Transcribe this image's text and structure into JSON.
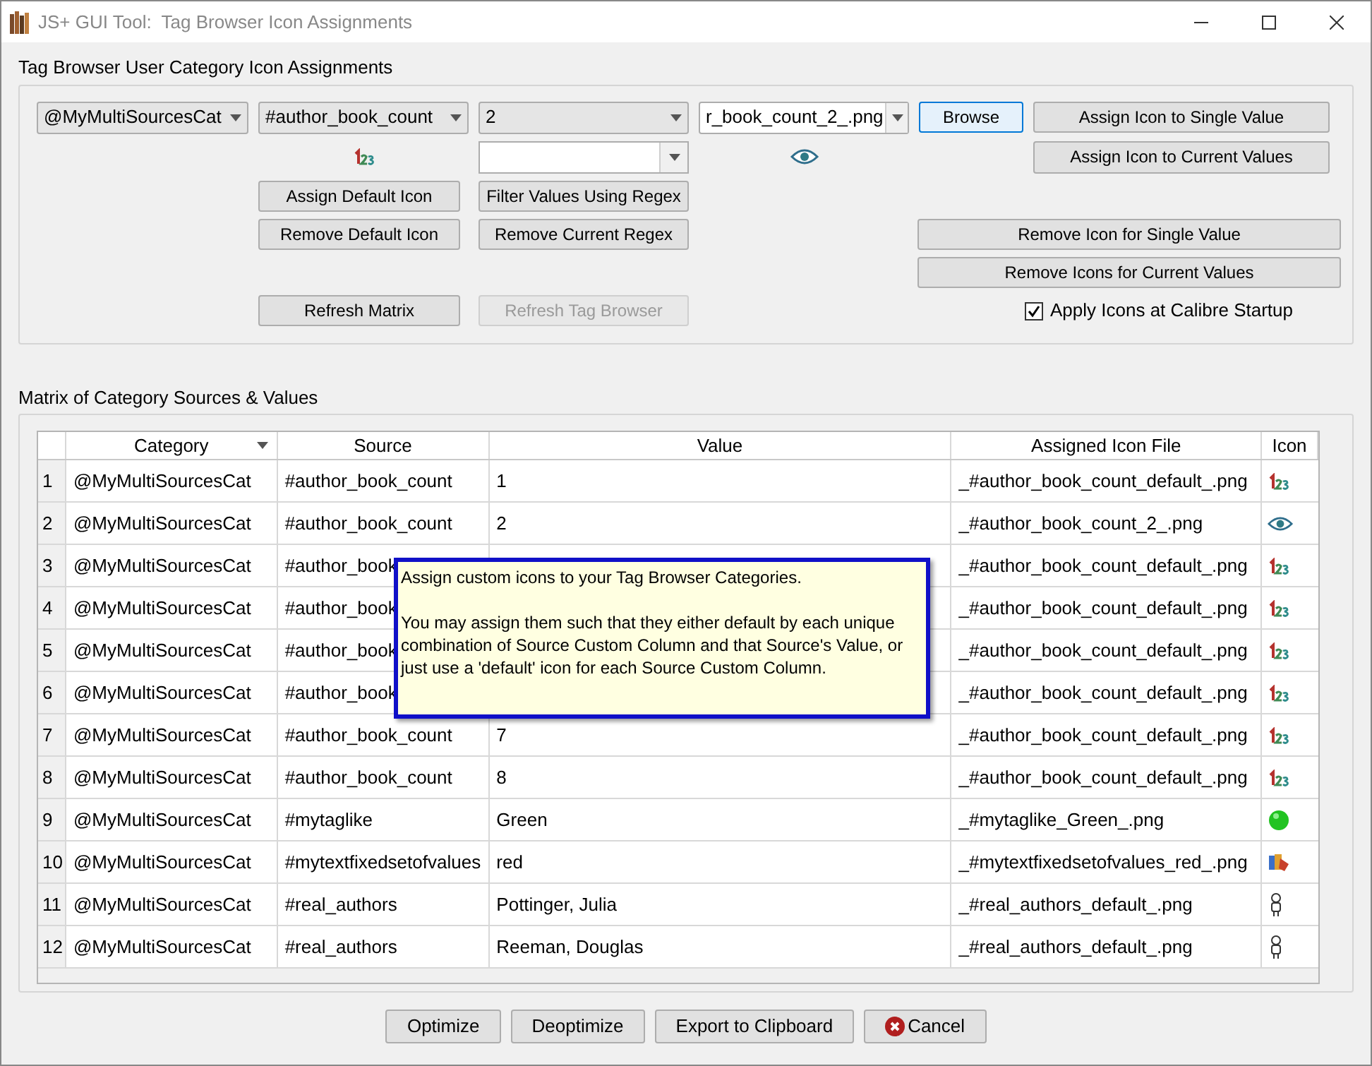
{
  "window": {
    "title": "JS+ GUI Tool:  Tag Browser Icon Assignments"
  },
  "assignments": {
    "title": "Tag Browser User Category Icon Assignments",
    "selectors": [
      {
        "value": "@MyMultiSourcesCat",
        "editable": false
      },
      {
        "value": "#author_book_count",
        "editable": false
      },
      {
        "value": "2",
        "editable": false
      },
      {
        "value": "r_book_count_2_.png",
        "editable": true
      }
    ],
    "browse_button": {
      "label": "Browse",
      "default": true
    },
    "assign_single_button": {
      "label": "Assign Icon to Single Value"
    },
    "assign_current_button": {
      "label": "Assign Icon to Current Values"
    },
    "assign_default_button": {
      "label": "Assign Default Icon"
    },
    "filter_regex_button": {
      "label": "Filter Values Using Regex"
    },
    "remove_default_button": {
      "label": "Remove Default Icon"
    },
    "remove_regex_button": {
      "label": "Remove Current Regex"
    },
    "remove_single_button": {
      "label": "Remove Icon for Single Value"
    },
    "remove_current_button": {
      "label": "Remove Icons for Current Values"
    },
    "refresh_matrix_button": {
      "label": "Refresh Matrix",
      "disabled": false
    },
    "refresh_browser_button": {
      "label": "Refresh Tag Browser",
      "disabled": true
    },
    "startup_checkbox": {
      "label": "Apply Icons at Calibre Startup",
      "checked": true
    }
  },
  "matrix": {
    "title": "Matrix of Category Sources & Values",
    "columns": [
      {
        "label": "Category",
        "sorted": true
      },
      {
        "label": "Source",
        "sorted": false
      },
      {
        "label": "Value",
        "sorted": false
      },
      {
        "label": "Assigned Icon File",
        "sorted": false
      },
      {
        "label": "Icon",
        "sorted": false
      }
    ],
    "rows": [
      {
        "number": "1",
        "category": "@MyMultiSourcesCat",
        "source": "#author_book_count",
        "value": "1",
        "file": "_#author_book_count_default_.png",
        "kind": "numbers"
      },
      {
        "number": "2",
        "category": "@MyMultiSourcesCat",
        "source": "#author_book_count",
        "value": "2",
        "file": "_#author_book_count_2_.png",
        "kind": "eye"
      },
      {
        "number": "3",
        "category": "@MyMultiSourcesCat",
        "source": "#author_book",
        "file": "_#author_book_count_default_.png",
        "kind": "numbers"
      },
      {
        "number": "4",
        "category": "@MyMultiSourcesCat",
        "source": "#author_book",
        "file": "_#author_book_count_default_.png",
        "kind": "numbers"
      },
      {
        "number": "5",
        "category": "@MyMultiSourcesCat",
        "source": "#author_book",
        "file": "_#author_book_count_default_.png",
        "kind": "numbers"
      },
      {
        "number": "6",
        "category": "@MyMultiSourcesCat",
        "source": "#author_book",
        "file": "_#author_book_count_default_.png",
        "kind": "numbers"
      },
      {
        "number": "7",
        "category": "@MyMultiSourcesCat",
        "source": "#author_book_count",
        "value": "7",
        "file": "_#author_book_count_default_.png",
        "kind": "numbers"
      },
      {
        "number": "8",
        "category": "@MyMultiSourcesCat",
        "source": "#author_book_count",
        "value": "8",
        "file": "_#author_book_count_default_.png",
        "kind": "numbers"
      },
      {
        "number": "9",
        "category": "@MyMultiSourcesCat",
        "source": "#mytaglike",
        "value": "Green",
        "file": "_#mytaglike_Green_.png",
        "kind": "dot"
      },
      {
        "number": "10",
        "category": "@MyMultiSourcesCat",
        "source": "#mytextfixedsetofvalues",
        "value": "red",
        "file": "_#mytextfixedsetofvalues_red_.png",
        "kind": "palette"
      },
      {
        "number": "11",
        "category": "@MyMultiSourcesCat",
        "source": "#real_authors",
        "value": "Pottinger, Julia",
        "file": "_#real_authors_default_.png",
        "kind": "person"
      },
      {
        "number": "12",
        "category": "@MyMultiSourcesCat",
        "source": "#real_authors",
        "value": "Reeman, Douglas",
        "file": "_#real_authors_default_.png",
        "kind": "person"
      }
    ]
  },
  "tooltip": {
    "paragraphs": [
      "Assign custom icons to your Tag Browser Categories.",
      "You may assign them such that they either default by each unique combination of Source Custom Column and that Source's Value, or just use a 'default' icon for each Source Custom Column."
    ]
  },
  "footer_buttons": [
    {
      "label": "Optimize",
      "kind": "plain"
    },
    {
      "label": "Deoptimize",
      "kind": "plain"
    },
    {
      "label": "Export to Clipboard",
      "kind": "plain"
    },
    {
      "label": "Cancel",
      "kind": "cancel"
    }
  ]
}
